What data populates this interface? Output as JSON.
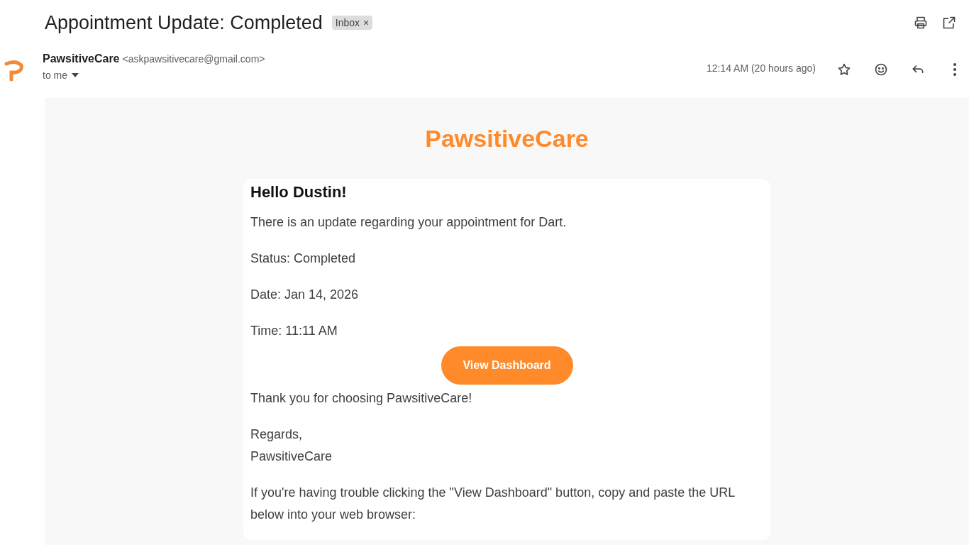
{
  "subject": "Appointment Update: Completed",
  "label": {
    "text": "Inbox",
    "remove": "×"
  },
  "sender": {
    "name": "PawsitiveCare",
    "email": "<askpawsitivecare@gmail.com>",
    "recipient": "to me"
  },
  "time": "12:14 AM (20 hours ago)",
  "starred": false,
  "email": {
    "brand": "PawsitiveCare",
    "greeting": "Hello Dustin!",
    "paragraphs": [
      {
        "kind": "text",
        "lines": [
          "There is an update regarding your appointment for Dart."
        ]
      },
      {
        "kind": "text",
        "lines": [
          "Status: Completed"
        ]
      },
      {
        "kind": "text",
        "lines": [
          "Date: Jan 14, 2026"
        ]
      },
      {
        "kind": "text",
        "lines": [
          "Time: 11:11 AM"
        ]
      },
      {
        "kind": "button",
        "label": "View Dashboard"
      },
      {
        "kind": "text",
        "lines": [
          "Thank you for choosing PawsitiveCare!"
        ]
      },
      {
        "kind": "text",
        "lines": [
          "Regards,",
          "PawsitiveCare"
        ]
      },
      {
        "kind": "text",
        "lines": [
          "If you're having trouble clicking the \"View Dashboard\" button, copy and paste the URL below into your web browser:"
        ]
      }
    ]
  }
}
